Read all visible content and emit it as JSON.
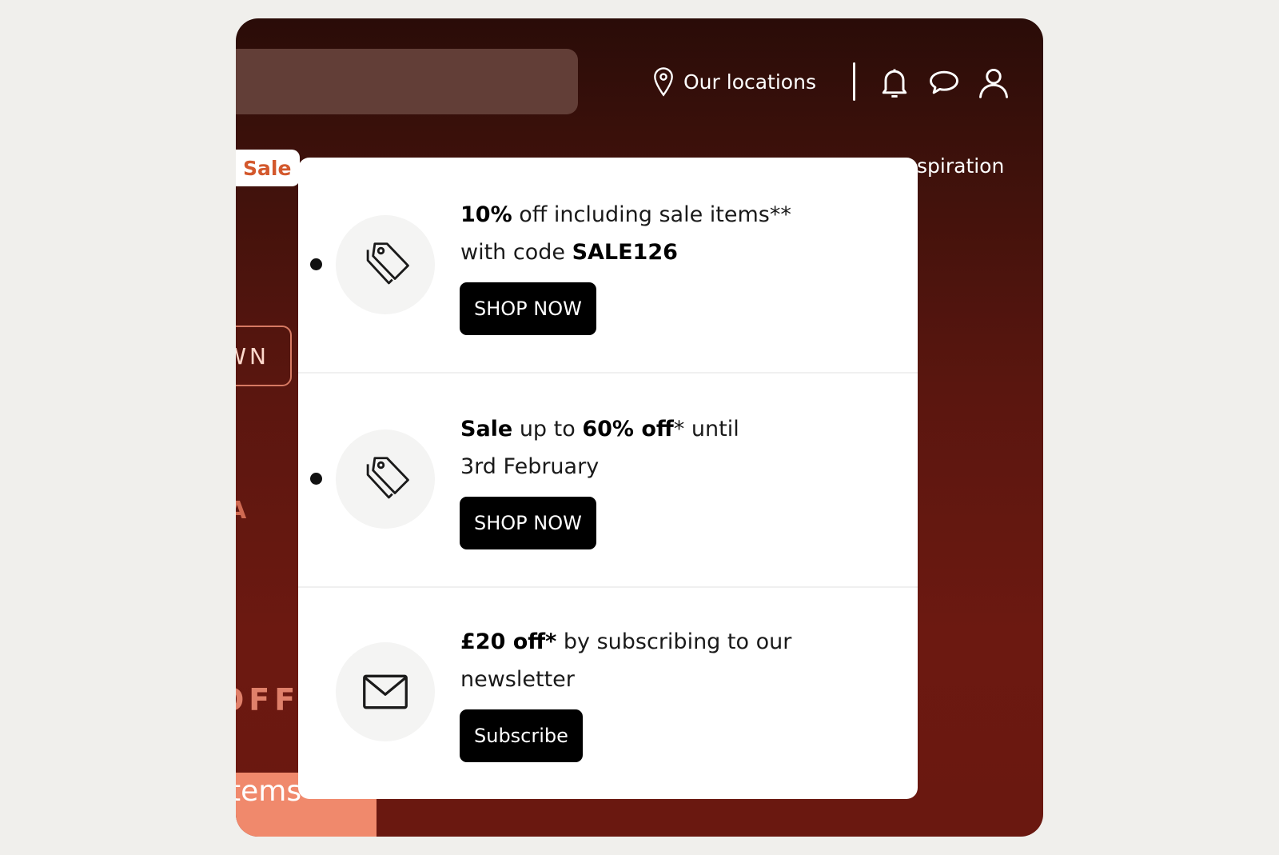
{
  "header": {
    "locations_label": "Our locations",
    "icons": [
      "location-pin-icon",
      "bell-icon",
      "chat-icon",
      "user-icon"
    ]
  },
  "nav": {
    "sale_label": "Sale",
    "inspiration_label": "spiration"
  },
  "background": {
    "outline_button_text": "WN",
    "letter_text": "A",
    "off_text": "OFF",
    "items_text": "items"
  },
  "promos": [
    {
      "icon": "tag-icon",
      "text_bold_1": "10%",
      "text_1": " off including sale items**",
      "text_2": "with code ",
      "text_bold_2": "SALE126",
      "button_label": "SHOP NOW"
    },
    {
      "icon": "tag-icon",
      "text_bold_1": "Sale",
      "text_1": " up to ",
      "text_bold_2": "60% off",
      "text_2": "* until 3rd February",
      "button_label": "SHOP NOW"
    },
    {
      "icon": "envelope-icon",
      "text_bold_1": "£20 off*",
      "text_1": " by subscribing to our newsletter",
      "button_label": "Subscribe"
    }
  ],
  "colors": {
    "page_bg": "#f0efec",
    "header_dark": "#2a0c08",
    "brand_red": "#6c1911",
    "sale_orange": "#d3582c",
    "button_black": "#000000",
    "salmon": "#f0896c"
  }
}
